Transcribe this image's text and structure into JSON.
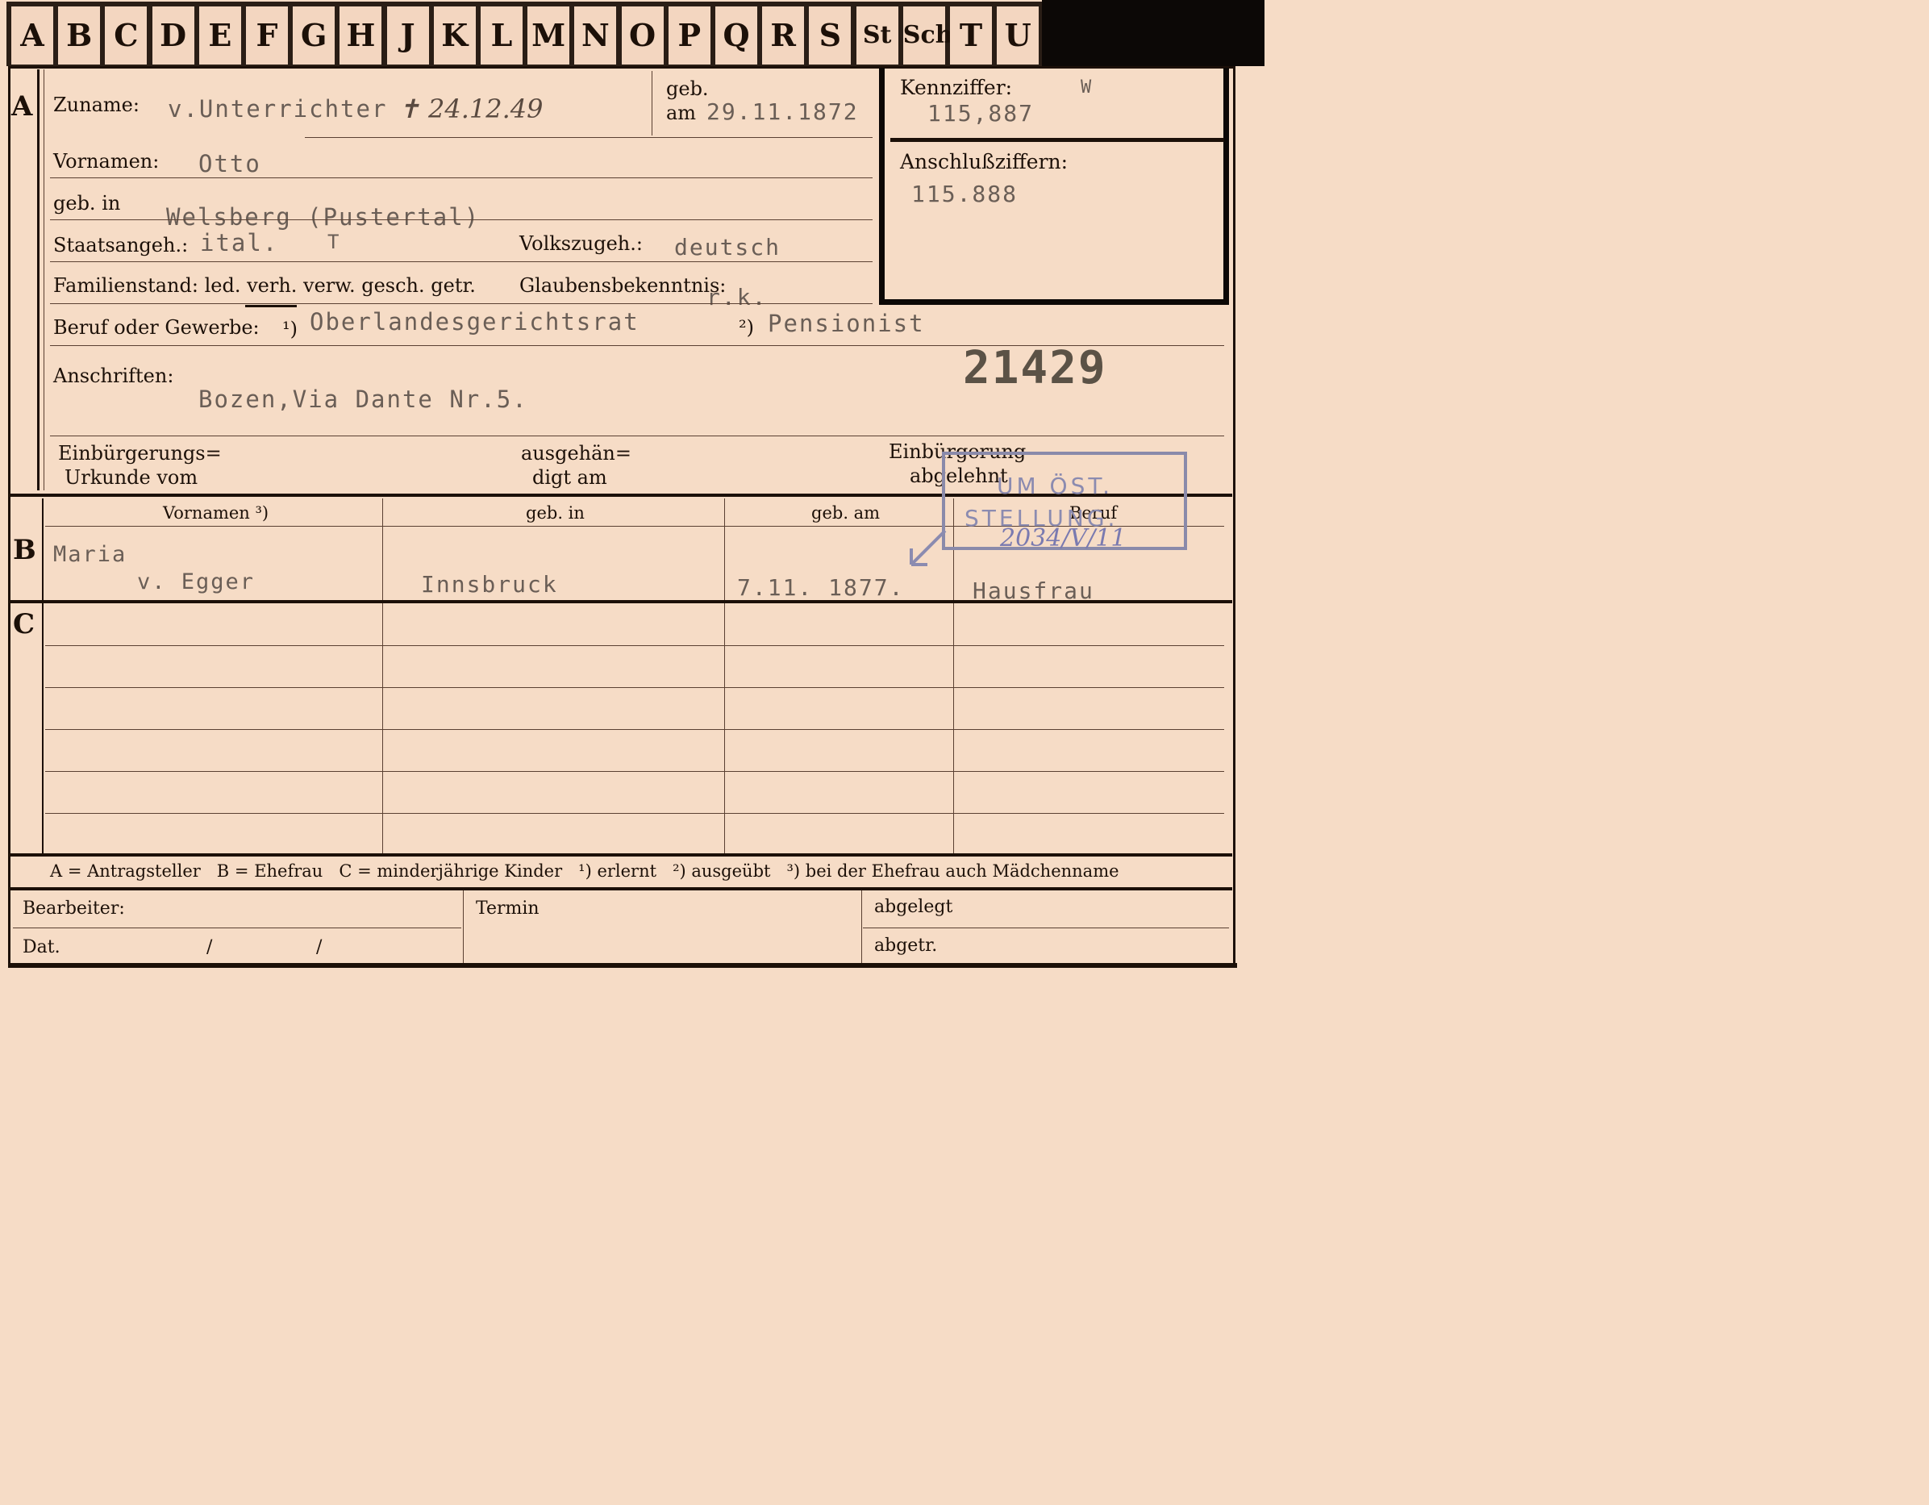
{
  "tabs": [
    "A",
    "B",
    "C",
    "D",
    "E",
    "F",
    "G",
    "H",
    "J",
    "K",
    "L",
    "M",
    "N",
    "O",
    "P",
    "Q",
    "R",
    "S",
    "St",
    "Sch",
    "T",
    "U"
  ],
  "sections": {
    "a": "A",
    "b": "B",
    "c": "C"
  },
  "labels": {
    "zuname": "Zuname:",
    "geb": "geb.",
    "am": "am",
    "vornamen": "Vornamen:",
    "geb_in": "geb. in",
    "staatsangeh": "Staatsangeh.:",
    "volkszugeh": "Volkszugeh.:",
    "familienstand": "Familienstand: led. verh. verw. gesch. getr.",
    "glaubensbekenntnis": "Glaubensbekenntnis:",
    "beruf": "Beruf oder Gewerbe:",
    "fn1": "¹)",
    "fn2": "²)",
    "anschriften": "Anschriften:",
    "einbuergerungs_urkunde_1": "Einbürgerungs=",
    "einbuergerungs_urkunde_2": "Urkunde vom",
    "ausgehaendigt_1": "ausgehän=",
    "ausgehaendigt_2": "digt am",
    "einbuergerung_abgelehnt_1": "Einbürgerung",
    "einbuergerung_abgelehnt_2": "abgelehnt",
    "kennziffer": "Kennziffer:",
    "anschlussziffern": "Anschlußziffern:"
  },
  "person": {
    "zuname": "v.Unterrichter",
    "death_note": "✝ 24.12.49",
    "geb_am": "29.11.1872",
    "vornamen": "Otto",
    "geb_in": "Welsberg (Pustertal)",
    "staatsangeh": "ital.",
    "staatsangeh_mark": "T",
    "volkszugeh": "deutsch",
    "glaubensbekenntnis": "r.k.",
    "beruf_erlernt": "Oberlandesgerichtsrat",
    "beruf_ausgeuebt": "Pensionist",
    "anschrift": "Bozen,Via Dante Nr.5.",
    "record_number": "21429",
    "kennziffer": "115,887",
    "kennziffer_mark": "W",
    "anschlussziffer": "115.888"
  },
  "table_headers": {
    "vornamen": "Vornamen ³)",
    "geb_in": "geb. in",
    "geb_am": "geb. am",
    "beruf": "Beruf"
  },
  "spouse": {
    "vornamen_1": "Maria",
    "vornamen_2": "v. Egger",
    "geb_in": "Innsbruck",
    "geb_am": "7.11. 1877.",
    "beruf": "Hausfrau"
  },
  "stamp": {
    "line1": "UM ÖST.",
    "line2": "STELLUNG.",
    "note": "2034/V/11"
  },
  "legend": "A = Antragsteller   B = Ehefrau   C = minderjährige Kinder   ¹) erlernt   ²) ausgeübt   ³) bei der Ehefrau auch Mädchenname",
  "footer": {
    "bearbeiter": "Bearbeiter:",
    "termin": "Termin",
    "abgelegt": "abgelegt",
    "dat": "Dat.",
    "slash1": "/",
    "slash2": "/",
    "abgetr": "abgetr."
  }
}
